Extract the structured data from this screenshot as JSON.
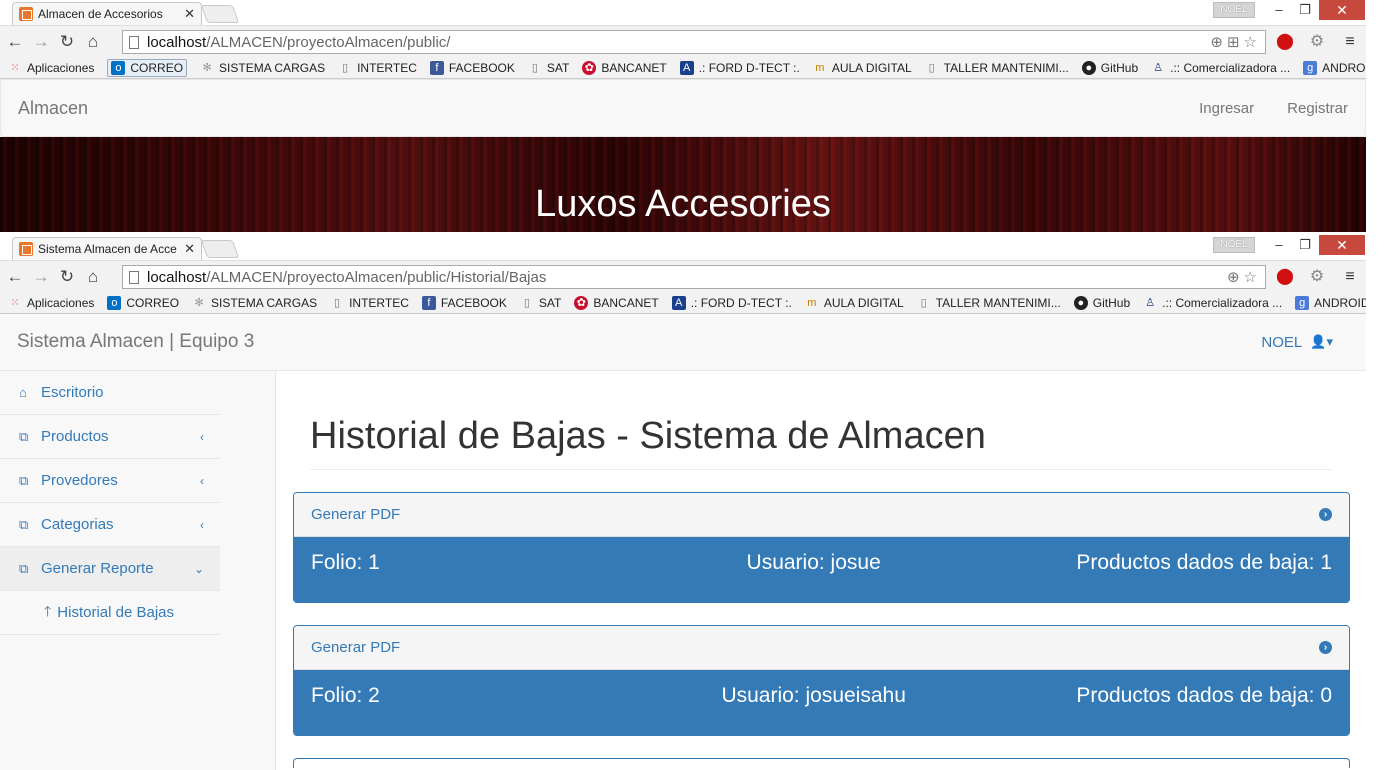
{
  "window1": {
    "tab_title": "Almacen de Accesorios",
    "user_badge": "NOEL",
    "url_host": "localhost",
    "url_path": "/ALMACEN/proyectoAlmacen/public/",
    "navbar_brand": "Almacen",
    "nav_links": [
      "Ingresar",
      "Registrar"
    ],
    "hero_title": "Luxos Accesories"
  },
  "window2": {
    "tab_title": "Sistema Almacen de Acce",
    "user_badge": "NOEL",
    "url_host": "localhost",
    "url_path": "/ALMACEN/proyectoAlmacen/public/Historial/Bajas",
    "navbar_brand": "Sistema Almacen | Equipo 3",
    "user_menu": "NOEL",
    "sidebar": {
      "items": [
        {
          "label": "Escritorio",
          "icon": "home-icon"
        },
        {
          "label": "Productos",
          "icon": "copy-icon"
        },
        {
          "label": "Provedores",
          "icon": "copy-icon"
        },
        {
          "label": "Categorias",
          "icon": "copy-icon"
        },
        {
          "label": "Generar Reporte",
          "icon": "copy-icon"
        }
      ],
      "subitem": {
        "label": "Historial de Bajas",
        "icon": "arrow-up-icon"
      }
    },
    "page_title": "Historial de Bajas - Sistema de Almacen",
    "panels": [
      {
        "header": "Generar PDF",
        "folio": "Folio: 1",
        "usuario": "Usuario: josue",
        "productos": "Productos dados de baja: 1"
      },
      {
        "header": "Generar PDF",
        "folio": "Folio: 2",
        "usuario": "Usuario: josueisahu",
        "productos": "Productos dados de baja: 0"
      }
    ]
  },
  "bookmarks": [
    "Aplicaciones",
    "CORREO",
    "SISTEMA CARGAS",
    "INTERTEC",
    "FACEBOOK",
    "SAT",
    "BANCANET",
    ".: FORD D-TECT :.",
    "AULA DIGITAL",
    "TALLER MANTENIMI...",
    "GitHub",
    ".:: Comercializadora ...",
    "ANDROID"
  ],
  "bookmarks_more": "»",
  "colors": {
    "primary": "#337ab7",
    "close_button": "#c7483c",
    "hero_dark": "#3a0707"
  }
}
